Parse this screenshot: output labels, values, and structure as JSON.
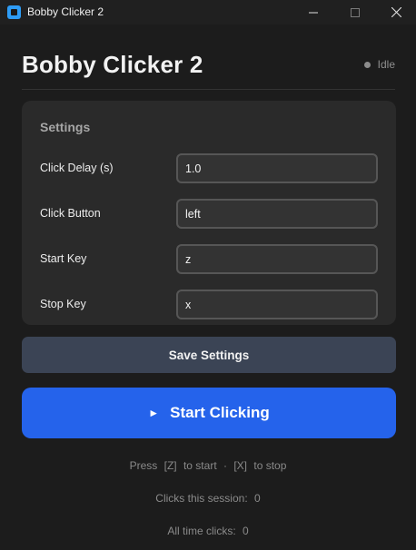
{
  "window": {
    "title": "Bobby Clicker 2"
  },
  "header": {
    "title": "Bobby Clicker 2",
    "status": "Idle"
  },
  "settings": {
    "title": "Settings",
    "fields": [
      {
        "label": "Click Delay (s)",
        "value": "1.0"
      },
      {
        "label": "Click Button",
        "value": "left"
      },
      {
        "label": "Start Key",
        "value": "z"
      },
      {
        "label": "Stop Key",
        "value": "x"
      }
    ]
  },
  "buttons": {
    "save_label": "Save Settings",
    "start_label": "Start Clicking",
    "start_icon": "play-icon"
  },
  "hints": {
    "press": "Press",
    "start_key": "[Z]",
    "to_start": "to start",
    "separator": "·",
    "stop_key": "[X]",
    "to_stop": "to stop"
  },
  "stats": {
    "session_label": "Clicks this session:",
    "session_value": "0",
    "alltime_label": "All time clicks:",
    "alltime_value": "0"
  },
  "colors": {
    "accent": "#2563eb",
    "save_button": "#3b4455",
    "app_icon": "#2e9cf5"
  }
}
